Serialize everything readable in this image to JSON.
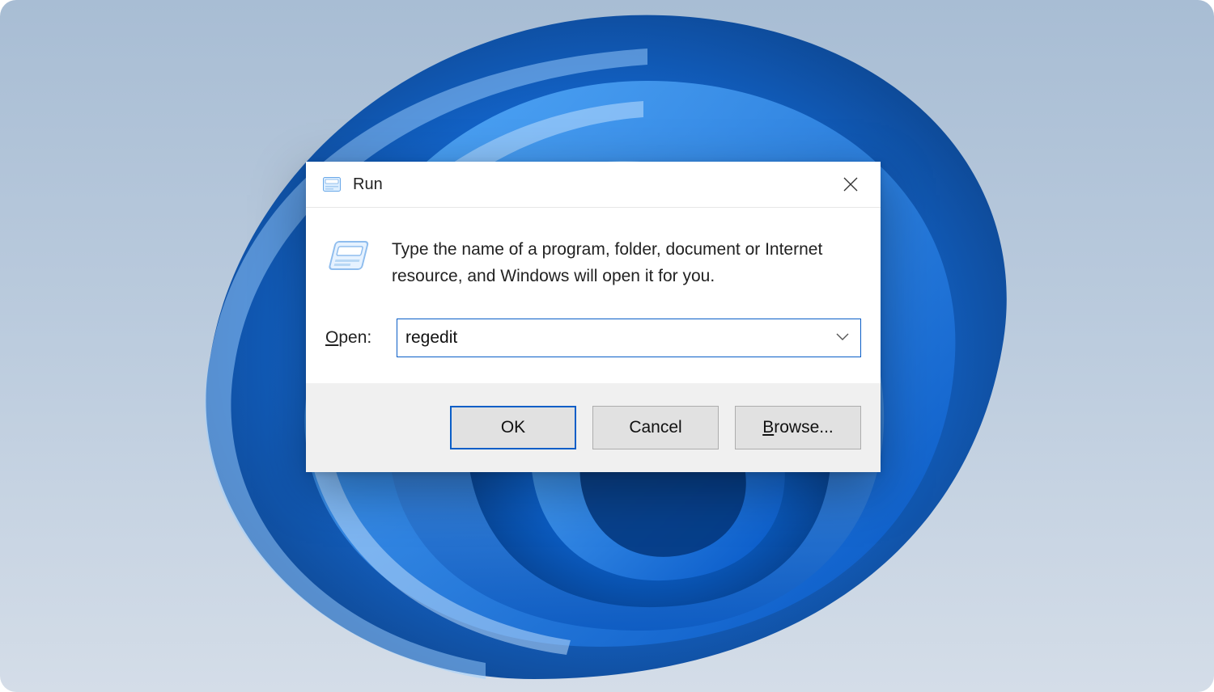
{
  "dialog": {
    "title": "Run",
    "description": "Type the name of a program, folder, document or Internet resource, and Windows will open it for you.",
    "open_label": "Open:",
    "open_accesskey": "O",
    "input_value": "regedit",
    "buttons": {
      "ok": "OK",
      "cancel": "Cancel",
      "browse": "Browse...",
      "browse_accesskey": "B"
    }
  }
}
